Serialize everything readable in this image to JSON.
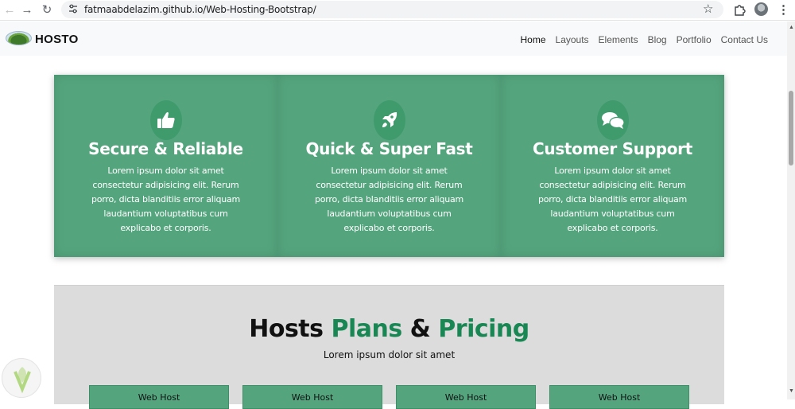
{
  "browser": {
    "url": "fatmaabdelazim.github.io/Web-Hosting-Bootstrap/",
    "icons": [
      "back-arrow-icon",
      "forward-arrow-icon",
      "reload-icon",
      "site-settings-icon",
      "star-icon",
      "extensions-icon",
      "profile-avatar",
      "menu-kebab-icon"
    ]
  },
  "navbar": {
    "brand": "HOSTO",
    "links": [
      {
        "label": "Home",
        "active": true
      },
      {
        "label": "Layouts",
        "active": false
      },
      {
        "label": "Elements",
        "active": false
      },
      {
        "label": "Blog",
        "active": false
      },
      {
        "label": "Portfolio",
        "active": false
      },
      {
        "label": "Contact Us",
        "active": false
      }
    ]
  },
  "features": [
    {
      "icon": "thumbs-up-icon",
      "title": "Secure & Reliable",
      "text": "Lorem ipsum dolor sit amet consectetur adipisicing elit. Rerum porro, dicta blanditiis error aliquam laudantium voluptatibus cum explicabo et corporis."
    },
    {
      "icon": "rocket-icon",
      "title": "Quick & Super Fast",
      "text": "Lorem ipsum dolor sit amet consectetur adipisicing elit. Rerum porro, dicta blanditiis error aliquam laudantium voluptatibus cum explicabo et corporis."
    },
    {
      "icon": "chat-bubbles-icon",
      "title": "Customer Support",
      "text": "Lorem ipsum dolor sit amet consectetur adipisicing elit. Rerum porro, dicta blanditiis error aliquam laudantium voluptatibus cum explicabo et corporis."
    }
  ],
  "pricing": {
    "title_part1": "Hosts",
    "title_part2": "Plans",
    "title_part3": "&",
    "title_part4": "Pricing",
    "subtitle": "Lorem ipsum dolor sit amet",
    "plans": [
      "Web Host",
      "Web Host",
      "Web Host",
      "Web Host"
    ]
  },
  "colors": {
    "feature_bg": "#54a57e",
    "accent_green": "#198754",
    "pricing_bg": "#dcdcdc",
    "navbar_bg": "#f8f9fa"
  }
}
